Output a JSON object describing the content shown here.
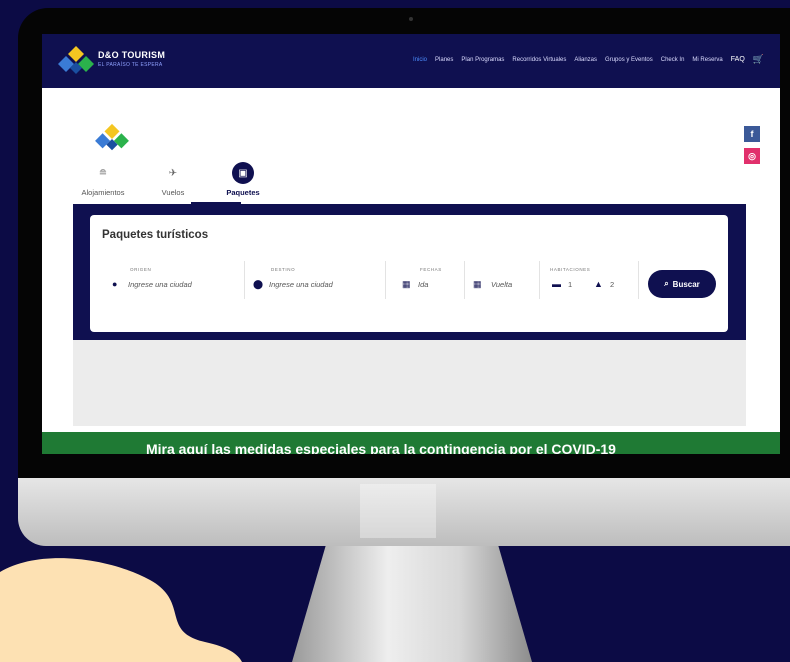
{
  "site": {
    "brand_name": "D&O TOURISM",
    "brand_tagline": "EL PARAÍSO TE ESPERA"
  },
  "nav": {
    "items": [
      "Inicio",
      "Planes",
      "Plan Programas",
      "Recorridos Virtuales",
      "Alianzas",
      "Grupos y Eventos",
      "Check In",
      "Mi Reserva"
    ],
    "active_index": 0,
    "faq": "FAQ"
  },
  "tabs": [
    {
      "label": "Alojamientos",
      "icon": "bed-icon"
    },
    {
      "label": "Vuelos",
      "icon": "plane-icon"
    },
    {
      "label": "Paquetes",
      "icon": "suitcase-icon"
    }
  ],
  "search": {
    "title": "Paquetes turísticos",
    "origin": {
      "label": "ORIGEN",
      "placeholder": "Ingrese una ciudad"
    },
    "destination": {
      "label": "DESTINO",
      "placeholder": "Ingrese una ciudad"
    },
    "dates": {
      "label": "FECHAS",
      "ida": "Ida",
      "vuelta": "Vuelta"
    },
    "rooms": {
      "label": "HABITACIONES",
      "rooms_count": "1",
      "guests_count": "2"
    },
    "button": "Buscar"
  },
  "social": {
    "facebook": "f",
    "instagram": "◎"
  },
  "banner": {
    "text": "Mira aquí las medidas especiales para la contingencia por el COVID-19"
  },
  "colors": {
    "navy": "#0f1050",
    "background": "#0c0b45",
    "banner_green": "#1f7a34",
    "cream": "#fde1b3"
  }
}
